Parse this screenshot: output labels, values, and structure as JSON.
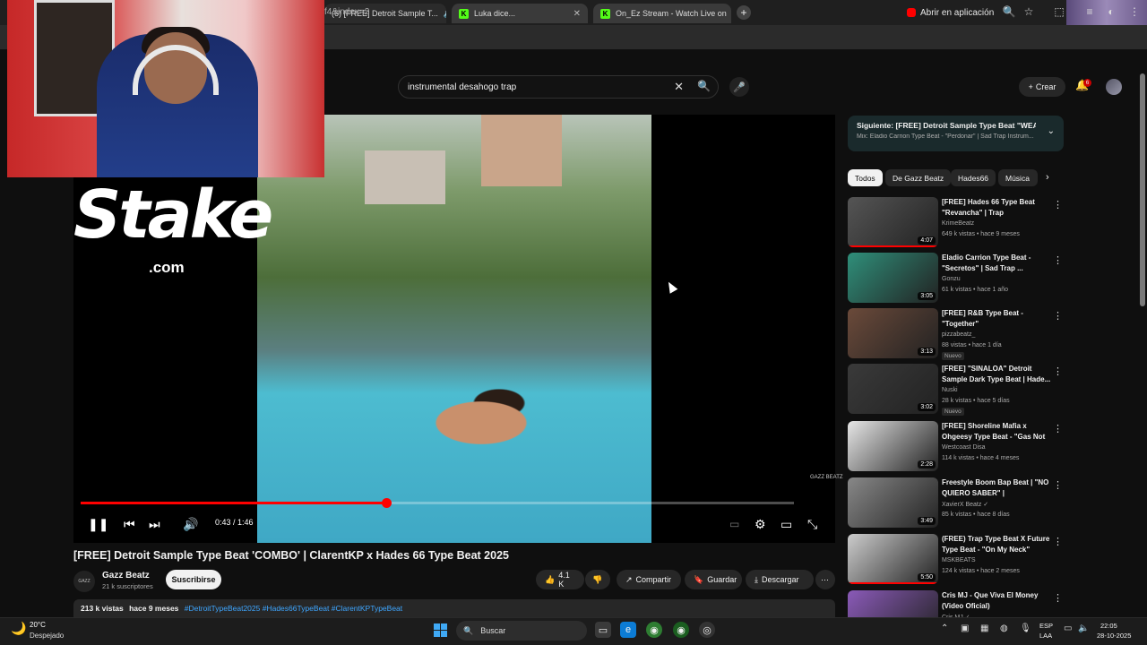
{
  "browser": {
    "tabs": [
      {
        "label": "(6) [FREE] Detroit Sample T..."
      },
      {
        "label": "Luka dice..."
      },
      {
        "label": "On_Ez Stream - Watch Live on"
      }
    ],
    "url_fragment": "f4&index=2",
    "open_in_app": "Abrir en aplicación"
  },
  "yt": {
    "search_value": "instrumental desahogo trap",
    "create_label": "Crear",
    "notif_count": "6"
  },
  "overlay": {
    "stake": "Stake",
    "stake_com": ".com",
    "watermark": "GAZZ BEATZ"
  },
  "player": {
    "time": "0:43 / 1:46",
    "progress_fraction": 0.428
  },
  "video": {
    "title": "[FREE] Detroit Sample Type Beat 'COMBO' | ClarentKP x Hades 66 Type Beat 2025",
    "channel": "Gazz Beatz",
    "channel_avatar_text": "GAZZ",
    "subs": "21 k suscriptores",
    "subscribe": "Suscribirse",
    "likes": "4.1 K",
    "share": "Compartir",
    "save": "Guardar",
    "download": "Descargar",
    "views": "213 k vistas",
    "age": "hace 9 meses",
    "tags": "#DetroitTypeBeat2025 #Hades66TypeBeat #ClarentKPTypeBeat"
  },
  "sidebar": {
    "next_title": "Siguiente: [FREE] Detroit Sample Type Beat \"WEAP...",
    "next_sub": "Mix: Eladio Carrion Type Beat - \"Perdonar\" | Sad Trap Instrum...",
    "chips": [
      "Todos",
      "De Gazz Beatz",
      "Hades66",
      "Música"
    ],
    "recs": [
      {
        "title": "[FREE] Hades 66 Type Beat \"Revancha\" | Trap Instrumental...",
        "channel": "KrimeBeatz",
        "meta": "649 k vistas • hace 9 meses",
        "dur": "4:07",
        "badge": "",
        "color": "#555",
        "watched": 1
      },
      {
        "title": "Eladio Carrion Type Beat - \"Secretos\" | Sad Trap ...",
        "channel": "Gonzu",
        "meta": "61 k vistas • hace 1 año",
        "dur": "3:05",
        "badge": "",
        "color": "#2f8f7a",
        "watched": 0
      },
      {
        "title": "[FREE] R&B Type Beat - \"Together\"",
        "channel": "pizzabeatz_",
        "meta": "88 vistas • hace 1 día",
        "dur": "3:13",
        "badge": "Nuevo",
        "color": "#6b4a3a",
        "watched": 0
      },
      {
        "title": "[FREE] \"SINALOA\" Detroit Sample Dark Type Beat | Hade...",
        "channel": "Nuski",
        "meta": "28 k vistas • hace 5 días",
        "dur": "3:02",
        "badge": "Nuevo",
        "color": "#3a3a3a",
        "watched": 0
      },
      {
        "title": "[FREE] Shoreline Mafia x Ohgeesy Type Beat - \"Gas Not ...",
        "channel": "Westcoast Disa",
        "meta": "114 k vistas • hace 4 meses",
        "dur": "2:28",
        "badge": "",
        "color": "#e6e6e6",
        "watched": 0
      },
      {
        "title": "Freestyle Boom Bap Beat | \"NO QUIERO SABER\" | Undergroun...",
        "channel": "XavierX Beatz ✓",
        "meta": "85 k vistas • hace 8 días",
        "dur": "3:49",
        "badge": "",
        "color": "#888",
        "watched": 0
      },
      {
        "title": "(FREE) Trap Type Beat X Future Type Beat - \"On My Neck\"",
        "channel": "MSKBEATS",
        "meta": "124 k vistas • hace 2 meses",
        "dur": "5:50",
        "badge": "",
        "color": "#ccc",
        "watched": 1
      },
      {
        "title": "Cris MJ - Que Viva El Money (Video Oficial)",
        "channel": "Cris MJ ✓",
        "meta": "",
        "dur": "",
        "badge": "",
        "color": "#8a5ab8",
        "watched": 0
      }
    ]
  },
  "taskbar": {
    "temp": "20°C",
    "weather": "Despejado",
    "search": "Buscar",
    "lang1": "ESP",
    "lang2": "LAA",
    "time": "22:05",
    "date": "28-10-2025"
  }
}
